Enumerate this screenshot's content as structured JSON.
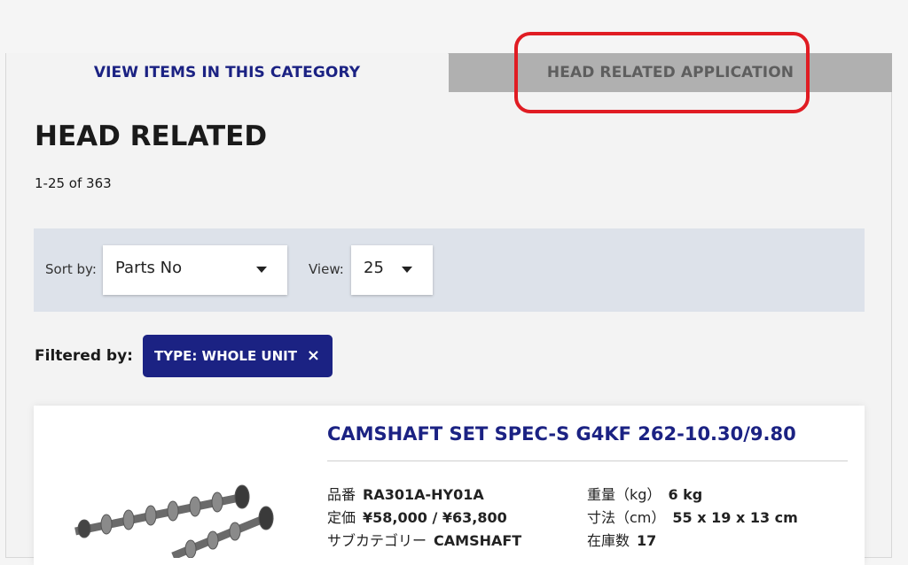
{
  "tabs": {
    "active_label": "VIEW ITEMS IN THIS CATEGORY",
    "inactive_label": "HEAD RELATED APPLICATION"
  },
  "page": {
    "title": "HEAD RELATED",
    "result_count": "1-25 of 363"
  },
  "toolbar": {
    "sort_label": "Sort by:",
    "sort_value": "Parts No",
    "view_label": "View:",
    "view_value": "25"
  },
  "filter": {
    "label": "Filtered by:",
    "chip_text": "TYPE: WHOLE UNIT",
    "chip_remove": "×"
  },
  "product": {
    "title": "CAMSHAFT SET SPEC-S G4KF 262-10.30/9.80",
    "part_no_label": "品番",
    "part_no": "RA301A-HY01A",
    "price_label": "定価",
    "price": "¥58,000 / ¥63,800",
    "subcategory_label": "サブカテゴリー",
    "subcategory": "CAMSHAFT",
    "weight_label": "重量（kg）",
    "weight": "6 kg",
    "dimensions_label": "寸法（cm）",
    "dimensions": "55 x 19 x 13 cm",
    "stock_label": "在庫数",
    "stock": "17"
  },
  "colors": {
    "brand_navy": "#1b2283",
    "highlight_red": "#e01c23",
    "inactive_tab": "#b0b0b0",
    "toolbar_bg": "#dde2ea"
  }
}
